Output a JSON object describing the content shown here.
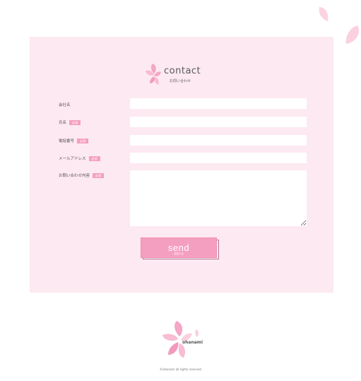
{
  "heading": {
    "title": "contact",
    "subtitle": "お問い合わせ"
  },
  "form": {
    "required_badge": "必須",
    "fields": {
      "company": {
        "label": "会社名",
        "value": ""
      },
      "name": {
        "label": "氏名",
        "value": ""
      },
      "phone": {
        "label": "電話番号",
        "value": ""
      },
      "email": {
        "label": "メールアドレス",
        "value": ""
      },
      "message": {
        "label": "お問い合わせ内容",
        "value": ""
      }
    },
    "submit": {
      "label": "send",
      "sublabel": "送信する"
    }
  },
  "footer": {
    "brand": "ohanami",
    "copyright": "©ohanami all rights reserved"
  },
  "colors": {
    "accent": "#f59fc0",
    "panel_bg": "#fde9f1",
    "petal_light": "#fbd0e0",
    "text": "#5a5a5a"
  },
  "icons": {
    "decor_petal": "sakura-petal-icon",
    "heading_logo": "sakura-flower-icon",
    "footer_logo": "sakura-flower-icon"
  }
}
